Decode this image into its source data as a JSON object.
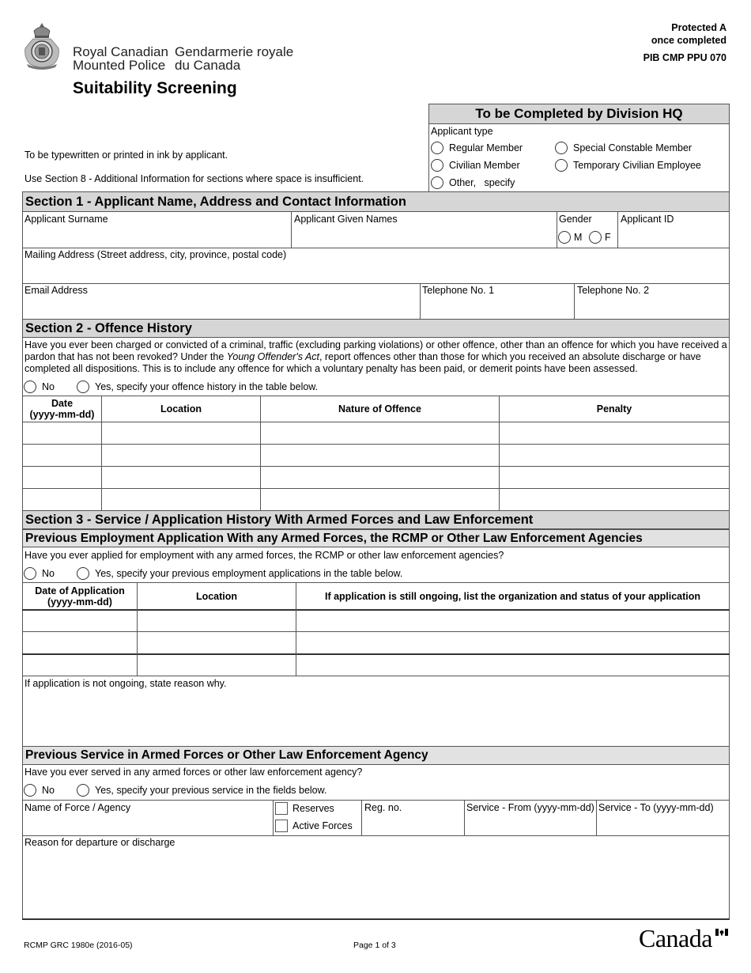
{
  "header": {
    "org_en_line1": "Royal Canadian",
    "org_en_line2": "Mounted Police",
    "org_fr_line1": "Gendarmerie royale",
    "org_fr_line2": "du Canada",
    "title": "Suitability Screening",
    "protected_line1": "Protected A",
    "protected_line2": "once completed",
    "pib": "PIB CMP PPU 070"
  },
  "instructions": [
    "To be typewritten or printed in ink by applicant.",
    "Use Section 8 - Additional Information for sections where space is insufficient."
  ],
  "division_hq": {
    "title": "To be Completed by Division HQ",
    "label": "Applicant type",
    "options": [
      "Regular Member",
      "Special Constable Member",
      "Civilian Member",
      "Temporary Civilian Employee",
      "Other,   specify"
    ]
  },
  "section1": {
    "title": "Section 1 - Applicant Name, Address and Contact Information",
    "surname": "Applicant Surname",
    "given_names": "Applicant Given Names",
    "gender": "Gender",
    "gender_m": "M",
    "gender_f": "F",
    "applicant_id": "Applicant ID",
    "mailing_address": "Mailing Address (Street address, city, province, postal code)",
    "email": "Email Address",
    "telephone1": "Telephone No. 1",
    "telephone2": "Telephone No. 2"
  },
  "section2": {
    "title": "Section 2 - Offence History",
    "question_part1": "Have you ever been charged or convicted of a criminal, traffic (excluding parking violations) or other offence, other than an offence for which you have received a pardon that has not been revoked? Under the ",
    "question_italic": "Young Offender's Act",
    "question_part2": ", report offences other than those for which you received an absolute discharge or have completed all dispositions. This is to include any offence for which a voluntary penalty has been paid, or demerit points have been assessed.",
    "no": "No",
    "yes": "Yes, specify your offence history in the table below.",
    "columns": [
      "Date (yyyy-mm-dd)",
      "Location",
      "Nature of Offence",
      "Penalty"
    ],
    "col0_line1": "Date",
    "col0_line2": "(yyyy-mm-dd)",
    "rows": [
      [
        "",
        "",
        "",
        ""
      ],
      [
        "",
        "",
        "",
        ""
      ],
      [
        "",
        "",
        "",
        ""
      ],
      [
        "",
        "",
        "",
        ""
      ]
    ]
  },
  "section3": {
    "title": "Section 3 - Service / Application History With Armed Forces and Law Enforcement",
    "employment": {
      "title": "Previous Employment Application With any Armed Forces, the RCMP or Other Law Enforcement Agencies",
      "question": "Have you ever applied for employment with any armed forces, the RCMP or other law enforcement agencies?",
      "no": "No",
      "yes": "Yes, specify your previous employment applications in the table below.",
      "col0_line1": "Date of Application",
      "col0_line2": "(yyyy-mm-dd)",
      "col1": "Location",
      "col2": "If application is still ongoing, list the organization and status of your application",
      "rows": [
        [
          "",
          "",
          ""
        ],
        [
          "",
          "",
          ""
        ],
        [
          "",
          "",
          ""
        ]
      ],
      "reason_label": "If application is not ongoing, state reason why."
    },
    "service": {
      "title": "Previous Service in Armed Forces or Other Law Enforcement Agency",
      "question": "Have you ever served in any armed forces or other law enforcement agency?",
      "no": "No",
      "yes": "Yes, specify your previous service in the fields below.",
      "name_of_force": "Name of Force / Agency",
      "reserves": "Reserves",
      "active_forces": "Active Forces",
      "reg_no": "Reg. no.",
      "service_from": "Service - From (yyyy-mm-dd)",
      "service_to": "Service - To (yyyy-mm-dd)",
      "reason_departure": "Reason for departure or discharge"
    }
  },
  "footer": {
    "form_number": "RCMP GRC 1980e (2016-05)",
    "page": "Page 1 of 3",
    "wordmark": "Canada"
  }
}
